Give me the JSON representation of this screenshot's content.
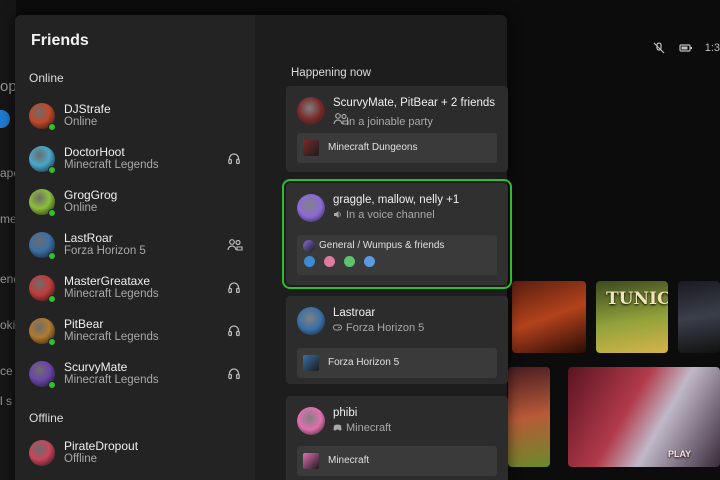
{
  "background": {
    "fragments": [
      "op",
      "ape",
      "me",
      "end",
      "okin",
      "ce",
      "l s"
    ],
    "status_time": "1:3"
  },
  "friends_panel": {
    "title": "Friends",
    "online_header": "Online",
    "offline_header": "Offline",
    "online": [
      {
        "name": "DJStrafe",
        "status": "Online",
        "presence_icon": "",
        "avatar_color": "#c0482a"
      },
      {
        "name": "DoctorHoot",
        "status": "Minecraft Legends",
        "presence_icon": "headset-icon",
        "avatar_color": "#4aa7c9"
      },
      {
        "name": "GrogGrog",
        "status": "Online",
        "presence_icon": "",
        "avatar_color": "#8cbf3a"
      },
      {
        "name": "LastRoar",
        "status": "Forza Horizon 5",
        "presence_icon": "party-icon",
        "avatar_color": "#3a6fa8"
      },
      {
        "name": "MasterGreataxe",
        "status": "Minecraft Legends",
        "presence_icon": "headset-icon",
        "avatar_color": "#c23b3b"
      },
      {
        "name": "PitBear",
        "status": "Minecraft Legends",
        "presence_icon": "headset-icon",
        "avatar_color": "#b07a2e"
      },
      {
        "name": "ScurvyMate",
        "status": "Minecraft Legends",
        "presence_icon": "headset-icon",
        "avatar_color": "#6a45a8"
      }
    ],
    "offline": [
      {
        "name": "PirateDropout",
        "status": "Offline",
        "avatar_color": "#c7465a"
      }
    ]
  },
  "happening_now": {
    "header": "Happening now",
    "cards": [
      {
        "title": "ScurvyMate, PitBear + 2 friends",
        "subtitle": "In a joinable party",
        "sub_icon": "party-icon",
        "activity": "Minecraft Dungeons",
        "selected": false,
        "accent": "#7a2a2a"
      },
      {
        "title": "graggle, mallow, nelly +1",
        "subtitle": "In a voice channel",
        "sub_icon": "speaker-icon",
        "activity": "General / Wumpus & friends",
        "selected": true,
        "accent": "#8a6ad8"
      },
      {
        "title": "Lastroar",
        "subtitle": "Forza Horizon 5",
        "sub_icon": "controller-icon",
        "activity": "Forza Horizon 5",
        "selected": false,
        "accent": "#3a6fa8"
      },
      {
        "title": "phibi",
        "subtitle": "Minecraft",
        "sub_icon": "discord-icon",
        "activity": "Minecraft",
        "selected": false,
        "accent": "#e070b0"
      }
    ]
  },
  "tiles": {
    "tunic_label": "TUNIC",
    "play_label": "PLAY"
  },
  "colors": {
    "accent_green": "#2fbd2f",
    "panel": "#232323"
  }
}
